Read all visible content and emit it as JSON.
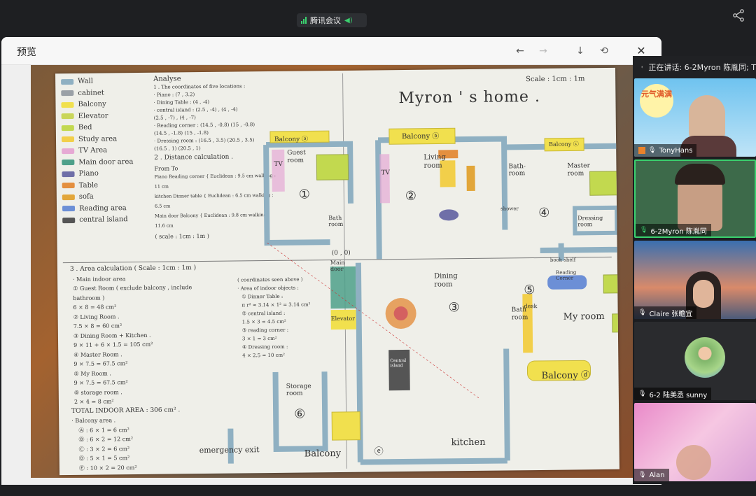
{
  "meeting": {
    "ghost_title": "",
    "app_name": "腾讯会议"
  },
  "preview": {
    "title": "预览",
    "buttons": {
      "prev": "←",
      "next": "→",
      "download": "↓",
      "rotate": "⟲",
      "close": "✕"
    }
  },
  "drawing": {
    "title": "Myron ' s home .",
    "scale": "Scale : 1cm : 1m",
    "legend": [
      {
        "label": "Wall",
        "color": "#8fb0c2"
      },
      {
        "label": "cabinet",
        "color": "#9aa0a6"
      },
      {
        "label": "Balcony",
        "color": "#f1e04e"
      },
      {
        "label": "Elevator",
        "color": "#c9d65a"
      },
      {
        "label": "Bed",
        "color": "#c2d94f"
      },
      {
        "label": "Study area",
        "color": "#f2cf4a"
      },
      {
        "label": "TV Area",
        "color": "#e6a9d4"
      },
      {
        "label": "Main door area",
        "color": "#4ea08a"
      },
      {
        "label": "Piano",
        "color": "#6f6fa8"
      },
      {
        "label": "Table",
        "color": "#e48f3f"
      },
      {
        "label": "sofa",
        "color": "#e2a63a"
      },
      {
        "label": "Reading area",
        "color": "#6c8fd6"
      },
      {
        "label": "central island",
        "color": "#555555"
      }
    ],
    "analyse": {
      "heading": "Analyse",
      "line1": "1 . The coordinates of five locations :",
      "lines": [
        "· Piano : (7 , 3.2)",
        "· Dining Table : (4 , -4)",
        "· central island : (2.5 , -4) , (4 , -4)",
        "(2.5 , -7) , (4 , -7)",
        "· Reading corner : (14.5 , -0.8) (15 , -0.8)",
        "(14.5 , -1.8) (15 , -1.8)",
        "· Dressing room : (16.5 , 3.5) (20.5 , 3.5)",
        "(16.5 , 1) (20.5 , 1)"
      ],
      "line2": "2 . Distance calculation .",
      "from_to": "From          To",
      "dist": [
        "Piano    Reading corner  { Euclidean : 9.5 cm  walking : 11 cm",
        "kitchen   Dinner table  { Euclidean : 6.5 cm  walking : 6.5 cm",
        "Main door  Balcony    { Euclidean : 9.8 cm  walking : 11.6 cm"
      ],
      "scale2": "( scale : 1cm : 1m )"
    },
    "area": {
      "heading": "3 . Area calculation  ( Scale : 1cm : 1m )",
      "lines": [
        "· Main indoor area",
        "① Guest Room ( exclude balcony , include bathroom )",
        "6 × 8 = 48 cm²",
        "② Living Room .",
        "7.5 × 8 = 60 cm²",
        "③ Dining Room + Kitchen .",
        "9 × 11 + 6 × 1.5 = 105 cm²",
        "④ Master Room .",
        "9 × 7.5 = 67.5 cm²",
        "⑤ My Room .",
        "9 × 7.5 = 67.5 cm²",
        "⑥ storage room .",
        "2 × 4 = 8 cm²"
      ],
      "total": "TOTAL INDOOR AREA : 306 cm² .",
      "balcony_heading": "· Balcony area .",
      "balcony": [
        "Ⓐ : 6 × 1 = 6 cm²",
        "Ⓑ : 6 × 2 = 12 cm²",
        "Ⓒ : 3 × 2 = 6 cm²",
        "Ⓓ : 5 × 1 = 5 cm²",
        "Ⓔ : 10 × 2 = 20 cm²"
      ]
    },
    "objects": {
      "heading": "( coordinates seen above )",
      "sub": "· Area of indoor objects :",
      "lines": [
        "① Dinner Table :",
        "π r² ≈ 3.14 × 1² = 3.14 cm²",
        "② central island :",
        "1.5 × 3 = 4.5 cm²",
        "③ reading corner :",
        "3 × 1 = 3 cm²",
        "④ Dressing room :",
        "4 × 2.5 = 10 cm²"
      ]
    },
    "rooms": {
      "balcony_a": "Balcony ⓐ",
      "balcony_b": "Balcony ⓑ",
      "balcony_c": "Balcony ⓒ",
      "balcony_d": "Balcony ⓓ",
      "balcony_e": "Balcony",
      "guest": "Guest room",
      "living": "Living room",
      "bath1": "Bath room",
      "bath2": "Bath-room",
      "bath3": "Bath room",
      "master": "Master room",
      "dressing": "Dressing room",
      "reading": "Reading Corner",
      "my_room": "My room",
      "dining": "Dining room",
      "kitchen": "kitchen",
      "storage": "Storage room",
      "elevator": "Elevator",
      "main_door": "Main door",
      "emergency": "emergency exit",
      "origin": "(0 , 0)",
      "central_island": "Central island",
      "shower": "shower",
      "book_shelf": "book shelf",
      "desk": "desk",
      "tv": "TV",
      "n1": "①",
      "n2": "②",
      "n3": "③",
      "n4": "④",
      "n5": "⑤",
      "n6": "⑥",
      "e_mark": "ⓔ"
    }
  },
  "panel": {
    "speaking": "正在讲话: 6-2Myron 陈胤同; T",
    "participants": [
      {
        "name": "TonyHans",
        "mic": "muted"
      },
      {
        "name": "6-2Myron 陈胤同",
        "mic": "on"
      },
      {
        "name": "Claire 张瞻宜",
        "mic": "muted"
      },
      {
        "name": "6-2 陆美丞 sunny",
        "mic": "muted"
      },
      {
        "name": "Alan",
        "mic": "muted"
      }
    ],
    "sticker_text": "元气满满"
  }
}
